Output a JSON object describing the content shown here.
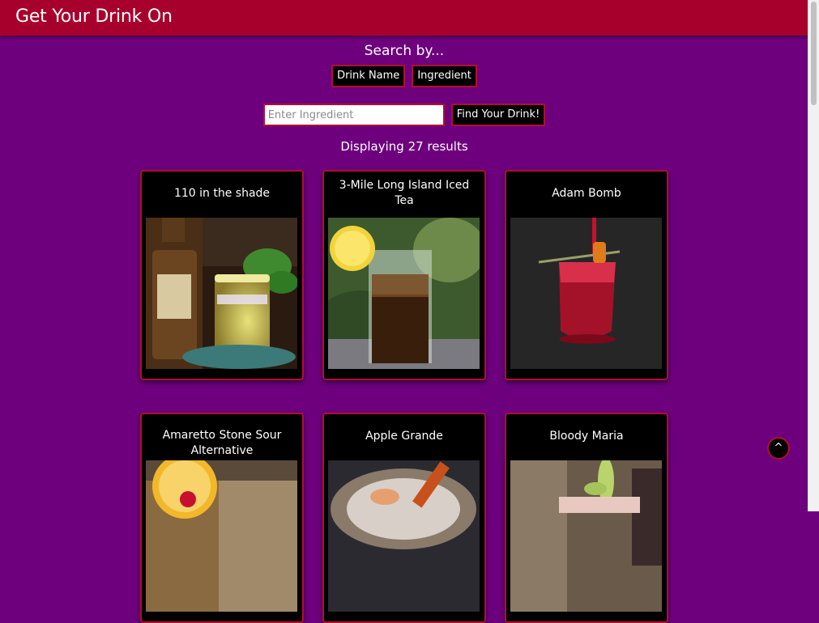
{
  "header": {
    "title": "Get Your Drink On"
  },
  "search": {
    "heading": "Search by...",
    "mode_buttons": [
      "Drink Name",
      "Ingredient"
    ],
    "placeholder": "Enter Ingredient",
    "value": "",
    "submit_label": "Find Your Drink!"
  },
  "results": {
    "count_text": "Displaying 27 results",
    "drinks": [
      {
        "name": "110 in the shade"
      },
      {
        "name": "3-Mile Long Island Iced Tea"
      },
      {
        "name": "Adam Bomb"
      },
      {
        "name": "Amaretto Stone Sour Alternative"
      },
      {
        "name": "Apple Grande"
      },
      {
        "name": "Bloody Maria"
      }
    ]
  },
  "scroll_top": {
    "label": "^"
  },
  "colors": {
    "background": "#6e007e",
    "header": "#a8002c",
    "accent_border": "#b0102e",
    "card": "#000000"
  }
}
